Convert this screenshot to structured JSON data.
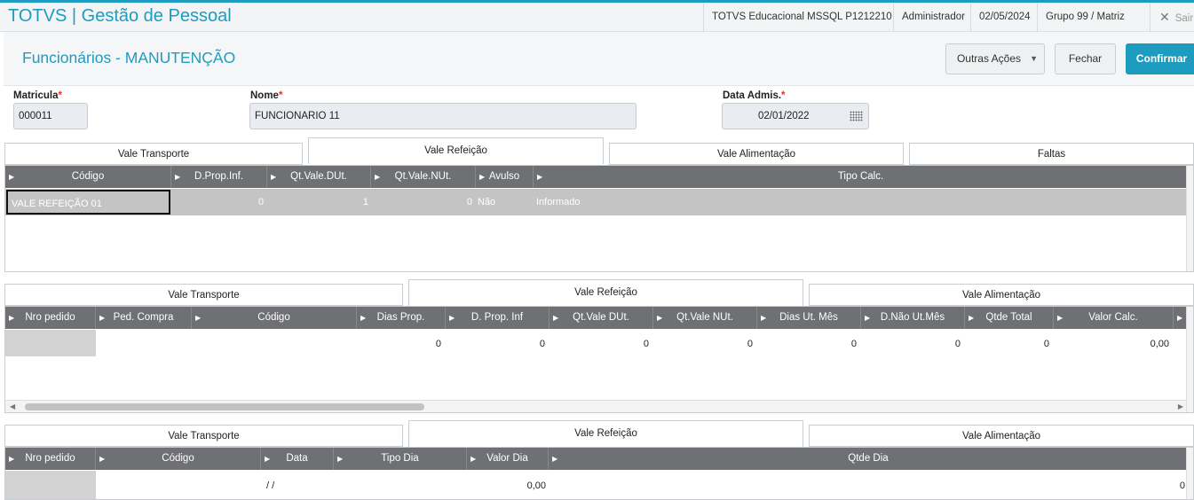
{
  "app": {
    "brand": "TOTVS",
    "separator": "|",
    "module": "Gestão de Pessoal"
  },
  "top_info": {
    "environment": "TOTVS Educacional MSSQL P1212210",
    "user": "Administrador",
    "date": "02/05/2024",
    "group": "Grupo 99 / Matriz",
    "exit_label": "Sair",
    "close_icon": "close-icon"
  },
  "page": {
    "title": "Funcionários - MANUTENÇÃO"
  },
  "buttons": {
    "more": "Outras Ações",
    "close": "Fechar",
    "confirm": "Confirmar"
  },
  "fields": {
    "matricula": {
      "label": "Matricula",
      "value": "000011"
    },
    "nome": {
      "label": "Nome",
      "value": "FUNCIONARIO 11"
    },
    "data_admis": {
      "label": "Data Admis.",
      "value": "02/01/2022"
    },
    "required_mark": "*"
  },
  "tabs1": [
    "Vale Transporte",
    "Vale Refeição",
    "Vale Alimentação",
    "Faltas"
  ],
  "grid1": {
    "headers": [
      "Código",
      "D.Prop.Inf.",
      "Qt.Vale.DUt.",
      "Qt.Vale.NUt.",
      "Avulso",
      "Tipo Calc."
    ],
    "row": [
      "VALE REFEIÇÃO 01",
      "0",
      "1",
      "0",
      "Não",
      "Informado"
    ]
  },
  "tabs2": [
    "Vale Transporte",
    "Vale Refeição",
    "Vale Alimentação"
  ],
  "grid2": {
    "headers": [
      "Nro pedido",
      "Ped. Compra",
      "Código",
      "Dias Prop.",
      "D. Prop. Inf",
      "Qt.Vale DUt.",
      "Qt.Vale NUt.",
      "Dias Ut. Mês",
      "D.Não Ut.Mês",
      "Qtde Total",
      "Valor Calc."
    ],
    "row": [
      "",
      "",
      "",
      "0",
      "0",
      "0",
      "0",
      "0",
      "0",
      "0",
      "0,00"
    ]
  },
  "tabs3": [
    "Vale Transporte",
    "Vale Refeição",
    "Vale Alimentação"
  ],
  "grid3": {
    "headers": [
      "Nro pedido",
      "Código",
      "Data",
      "Tipo Dia",
      "Valor Dia",
      "Qtde Dia"
    ],
    "row": [
      "",
      "",
      "/ /",
      "",
      "0,00",
      "0"
    ]
  },
  "colors": {
    "accent": "#1d9cc0",
    "grid_header": "#6e7073",
    "selected_row": "#c4c4c4"
  }
}
